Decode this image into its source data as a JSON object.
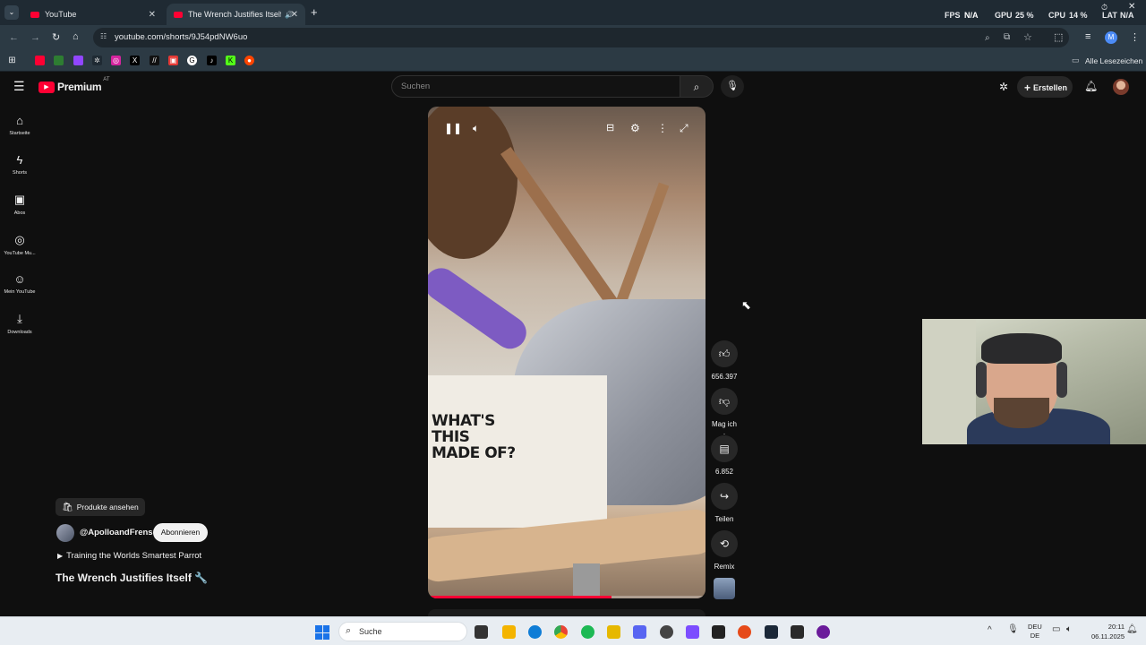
{
  "browser": {
    "tabs": [
      {
        "title": "YouTube",
        "active": false
      },
      {
        "title": "The Wrench Justifies Itself!",
        "active": true
      }
    ],
    "new_tab_icon": "plus-icon",
    "url": "youtube.com/shorts/9J54pdNW6uo",
    "bookmarks_label": "Alle Lesezeichen",
    "profile_initial": "M",
    "hud": {
      "fps_label": "FPS",
      "fps_value": "N/A",
      "gpu_label": "GPU",
      "gpu_value": "25 %",
      "cpu_label": "CPU",
      "cpu_value": "14 %",
      "lat_label": "LAT",
      "lat_value": "N/A"
    }
  },
  "youtube": {
    "logo_text": "Premium",
    "logo_region": "AT",
    "search_placeholder": "Suchen",
    "create_label": "Erstellen",
    "nav": [
      {
        "label": "Startseite",
        "icon": "home-icon"
      },
      {
        "label": "Shorts",
        "icon": "shorts-icon"
      },
      {
        "label": "Abos",
        "icon": "subscriptions-icon"
      },
      {
        "label": "YouTube Mu...",
        "icon": "music-icon"
      },
      {
        "label": "Mein YouTube",
        "icon": "account-icon"
      },
      {
        "label": "Downloads",
        "icon": "download-icon"
      }
    ],
    "short": {
      "shirt_text": "WHAT'S THIS MADE OF?",
      "products_label": "Produkte ansehen",
      "channel": "@ApolloandFrens",
      "subscribe_label": "Abonnieren",
      "playlist": "Training the Worlds Smartest Parrot",
      "title": "The Wrench Justifies Itself 🔧",
      "progress": 0.66
    },
    "actions": {
      "like_count": "656.397",
      "dislike_label": "Mag ich .",
      "comments_count": "6.852",
      "share_label": "Teilen",
      "remix_label": "Remix"
    }
  },
  "taskbar": {
    "search_label": "Suche",
    "lang_line1": "DEU",
    "lang_line2": "DE",
    "time": "20:11",
    "date": "06.11.2025"
  }
}
